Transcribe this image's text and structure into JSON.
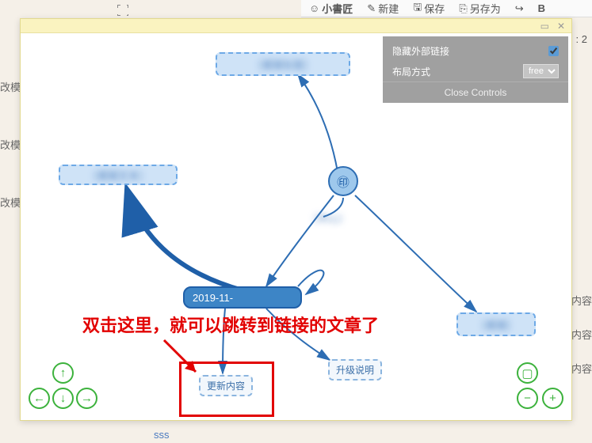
{
  "bg_toolbar": {
    "brand": "小書匠",
    "new": "新建",
    "save": "保存",
    "saveas": "另存为"
  },
  "bg_side_items": [
    "改模",
    "改模",
    "改模"
  ],
  "bg_right_items": [
    "内容",
    "内容",
    "内容"
  ],
  "bg_footer": "sss",
  "ctrl": {
    "hide_ext_links_label": "隐藏外部链接",
    "hide_ext_links_checked": true,
    "layout_label": "布局方式",
    "layout_value": "free",
    "close": "Close Controls"
  },
  "nodes": {
    "top": "（模糊标题）",
    "left": "（模糊文本）",
    "center_label": "（中心）",
    "date": "2019-11-",
    "update": "更新内容",
    "upgrade": "升级说明",
    "rightcard": "（模糊）"
  },
  "annotation": "双击这里，就可以跳转到链接的文章了",
  "page_hint": ": 2"
}
